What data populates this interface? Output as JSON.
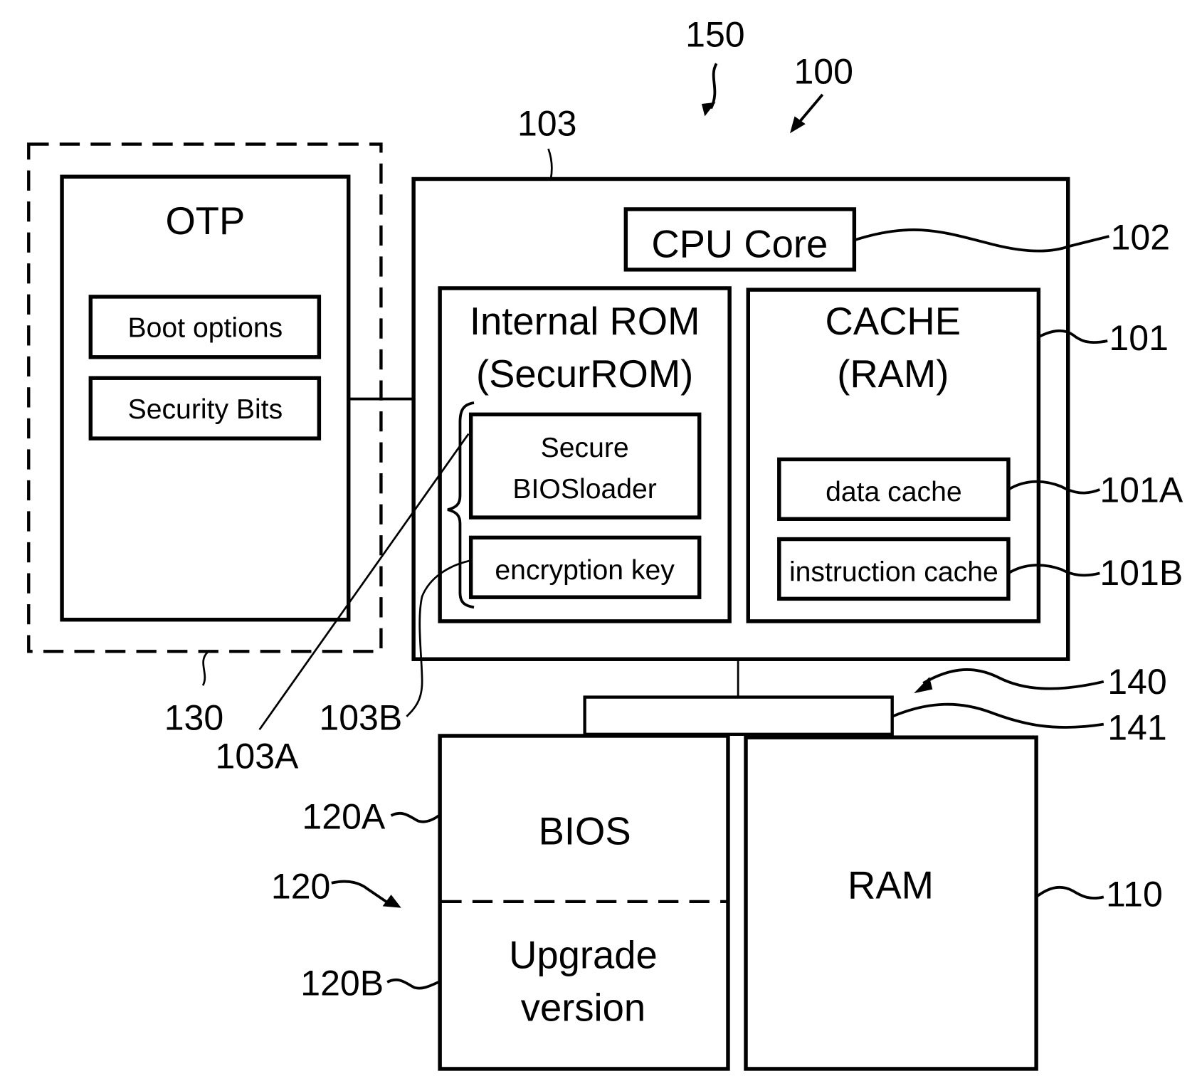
{
  "diagram": {
    "type": "block-diagram",
    "reference_numerals": {
      "system": "150",
      "cpu_unit": "100",
      "securrom_ref": "103",
      "cpu_core_ref": "102",
      "cache_ref": "101",
      "data_cache_ref": "101A",
      "instruction_cache_ref": "101B",
      "otp_group_ref": "130",
      "bios_loader_ref": "103A",
      "encryption_key_ref": "103B",
      "bus_ref": "140",
      "bus_block_ref": "141",
      "flash_ref": "120",
      "bios_ref": "120A",
      "upgrade_ref": "120B",
      "ram_ref": "110"
    },
    "otp": {
      "title": "OTP",
      "items": [
        "Boot options",
        "Security Bits"
      ]
    },
    "cpu_core": {
      "label": "CPU Core"
    },
    "internal_rom": {
      "title_line1": "Internal ROM",
      "title_line2": "(SecurROM)",
      "loader_line1": "Secure",
      "loader_line2": "BIOSloader",
      "key_label": "encryption key"
    },
    "cache": {
      "title_line1": "CACHE",
      "title_line2": "(RAM)",
      "data_cache": "data cache",
      "instruction_cache": "instruction cache"
    },
    "flash": {
      "bios_label": "BIOS",
      "upgrade_line1": "Upgrade",
      "upgrade_line2": "version"
    },
    "ram": {
      "label": "RAM"
    }
  }
}
